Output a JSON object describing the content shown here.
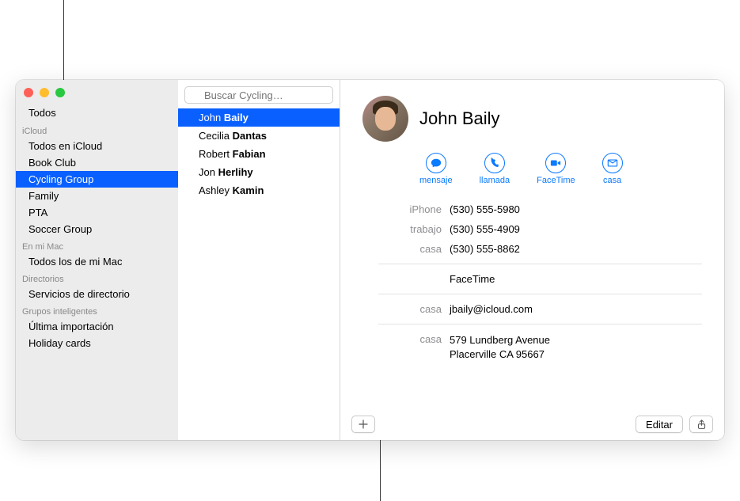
{
  "sidebar": {
    "top_item": "Todos",
    "sections": [
      {
        "header": "iCloud",
        "items": [
          "Todos en iCloud",
          "Book Club",
          "Cycling Group",
          "Family",
          "PTA",
          "Soccer Group"
        ],
        "selected_index": 2
      },
      {
        "header": "En mi Mac",
        "items": [
          "Todos los de mi Mac"
        ]
      },
      {
        "header": "Directorios",
        "items": [
          "Servicios de directorio"
        ]
      },
      {
        "header": "Grupos inteligentes",
        "items": [
          "Última importación",
          "Holiday cards"
        ]
      }
    ]
  },
  "search": {
    "placeholder": "Buscar Cycling…"
  },
  "contacts": {
    "list": [
      {
        "first": "John",
        "last": "Baily"
      },
      {
        "first": "Cecilia",
        "last": "Dantas"
      },
      {
        "first": "Robert",
        "last": "Fabian"
      },
      {
        "first": "Jon",
        "last": "Herlihy"
      },
      {
        "first": "Ashley",
        "last": "Kamin"
      }
    ],
    "selected_index": 0
  },
  "card": {
    "name": "John Baily",
    "actions": {
      "message": "mensaje",
      "call": "llamada",
      "facetime": "FaceTime",
      "mail": "casa"
    },
    "phones": [
      {
        "label": "iPhone",
        "value": "(530) 555-5980"
      },
      {
        "label": "trabajo",
        "value": "(530) 555-4909"
      },
      {
        "label": "casa",
        "value": "(530) 555-8862"
      }
    ],
    "facetime_label": "FaceTime",
    "email": {
      "label": "casa",
      "value": "jbaily@icloud.com"
    },
    "address": {
      "label": "casa",
      "street": "579 Lundberg Avenue",
      "city": "Placerville CA 95667"
    }
  },
  "buttons": {
    "edit": "Editar"
  }
}
